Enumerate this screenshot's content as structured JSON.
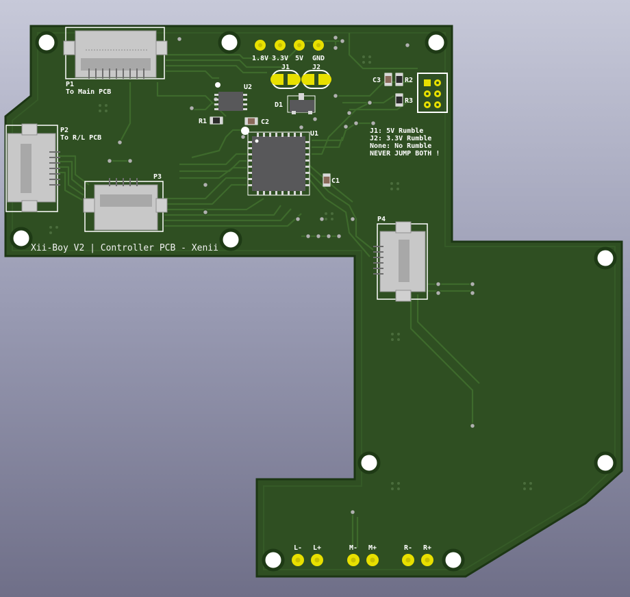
{
  "board": {
    "title": "Xii-Boy V2 | Controller PCB - Xenii",
    "colors": {
      "background": "#9a9cb4",
      "soldermask": "#2f4f22",
      "outline": "#1b3512",
      "trace": "#3e6a2c",
      "pad_gold": "#e8e000",
      "silkscreen": "#ffffff"
    }
  },
  "connectors": {
    "p1": {
      "ref": "P1",
      "desc": "To Main PCB"
    },
    "p2": {
      "ref": "P2",
      "desc": "To R/L PCB"
    },
    "p3": {
      "ref": "P3"
    },
    "p4": {
      "ref": "P4"
    }
  },
  "components": {
    "u1": "U1",
    "u2": "U2",
    "d1": "D1",
    "r1": "R1",
    "r2": "R2",
    "r3": "R3",
    "c1": "C1",
    "c2": "C2",
    "c3": "C3"
  },
  "power_pins": [
    "1.8V",
    "3.3V",
    "5V",
    "GND"
  ],
  "jumpers": {
    "j1": "J1",
    "j2": "J2"
  },
  "notes": [
    "J1: 5V Rumble",
    "J2: 3.3V Rumble",
    "None: No Rumble",
    "NEVER JUMP BOTH !"
  ],
  "motor_pins": [
    "L-",
    "L+",
    "M-",
    "M+",
    "R-",
    "R+"
  ]
}
